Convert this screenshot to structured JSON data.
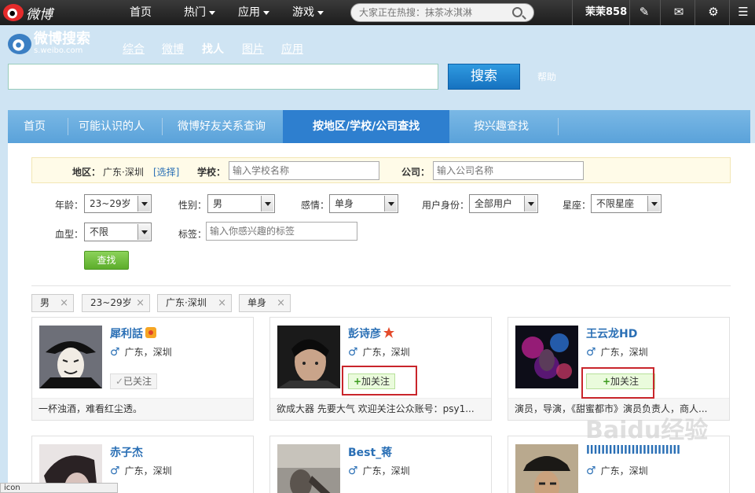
{
  "topbar": {
    "logo_text": "微博",
    "nav": [
      {
        "label": "首页",
        "caret": false
      },
      {
        "label": "热门",
        "caret": true
      },
      {
        "label": "应用",
        "caret": true
      },
      {
        "label": "游戏",
        "caret": true
      }
    ],
    "search_placeholder": "大家正在热搜：抹茶冰淇淋",
    "username": "茉茉858",
    "icons": [
      "edit-icon",
      "mail-icon",
      "gear-icon",
      "menu-icon"
    ]
  },
  "search_header": {
    "logo_title": "微博搜索",
    "logo_sub": "s.weibo.com",
    "tabs": [
      "综合",
      "微博",
      "找人",
      "图片",
      "应用"
    ],
    "active_tab": "找人",
    "search_button": "搜索",
    "help": "帮助"
  },
  "main_tabs": [
    "首页",
    "可能认识的人",
    "微博好友关系查询",
    "按地区/学校/公司查找",
    "按兴趣查找"
  ],
  "filter": {
    "region_label": "地区：",
    "region_value": "广东·深圳",
    "region_select": "[选择]",
    "school_label": "学校：",
    "school_placeholder": "输入学校名称",
    "company_label": "公司：",
    "company_placeholder": "输入公司名称"
  },
  "criteria": {
    "age_label": "年龄：",
    "age_value": "23~29岁",
    "gender_label": "性别：",
    "gender_value": "男",
    "relation_label": "感情：",
    "relation_value": "单身",
    "identity_label": "用户身份：",
    "identity_value": "全部用户",
    "zodiac_label": "星座：",
    "zodiac_value": "不限星座",
    "blood_label": "血型：",
    "blood_value": "不限",
    "tag_label": "标签：",
    "tag_placeholder": "输入你感兴趣的标签",
    "find_button": "查找"
  },
  "chips": [
    "男",
    "23~29岁",
    "广东·深圳",
    "单身"
  ],
  "chip_close": "×",
  "gender_symbol": "♂",
  "follow_plus": "+",
  "cards": [
    {
      "name": "犀利話",
      "location": "广东，深圳",
      "action": "已关注",
      "followed": true,
      "desc": "一杯浊酒，难看红尘透。"
    },
    {
      "name": "彭诗彦",
      "location": "广东，深圳",
      "action": "加关注",
      "followed": false,
      "desc": "欲成大器 先要大气 欢迎关注公众账号：psy1..."
    },
    {
      "name": "王云龙HD",
      "location": "广东，深圳",
      "action": "加关注",
      "followed": false,
      "desc": "演员，导演，《甜蜜都市》演员负责人，商人..."
    },
    {
      "name": "赤子杰",
      "location": "广东，深圳"
    },
    {
      "name": "Best_蒋",
      "location": "广东，深圳"
    },
    {
      "name": "lllllllllllllllllllllllll",
      "location": "广东，深圳"
    }
  ],
  "watermark": "Baidu经验",
  "status_text": "icon"
}
